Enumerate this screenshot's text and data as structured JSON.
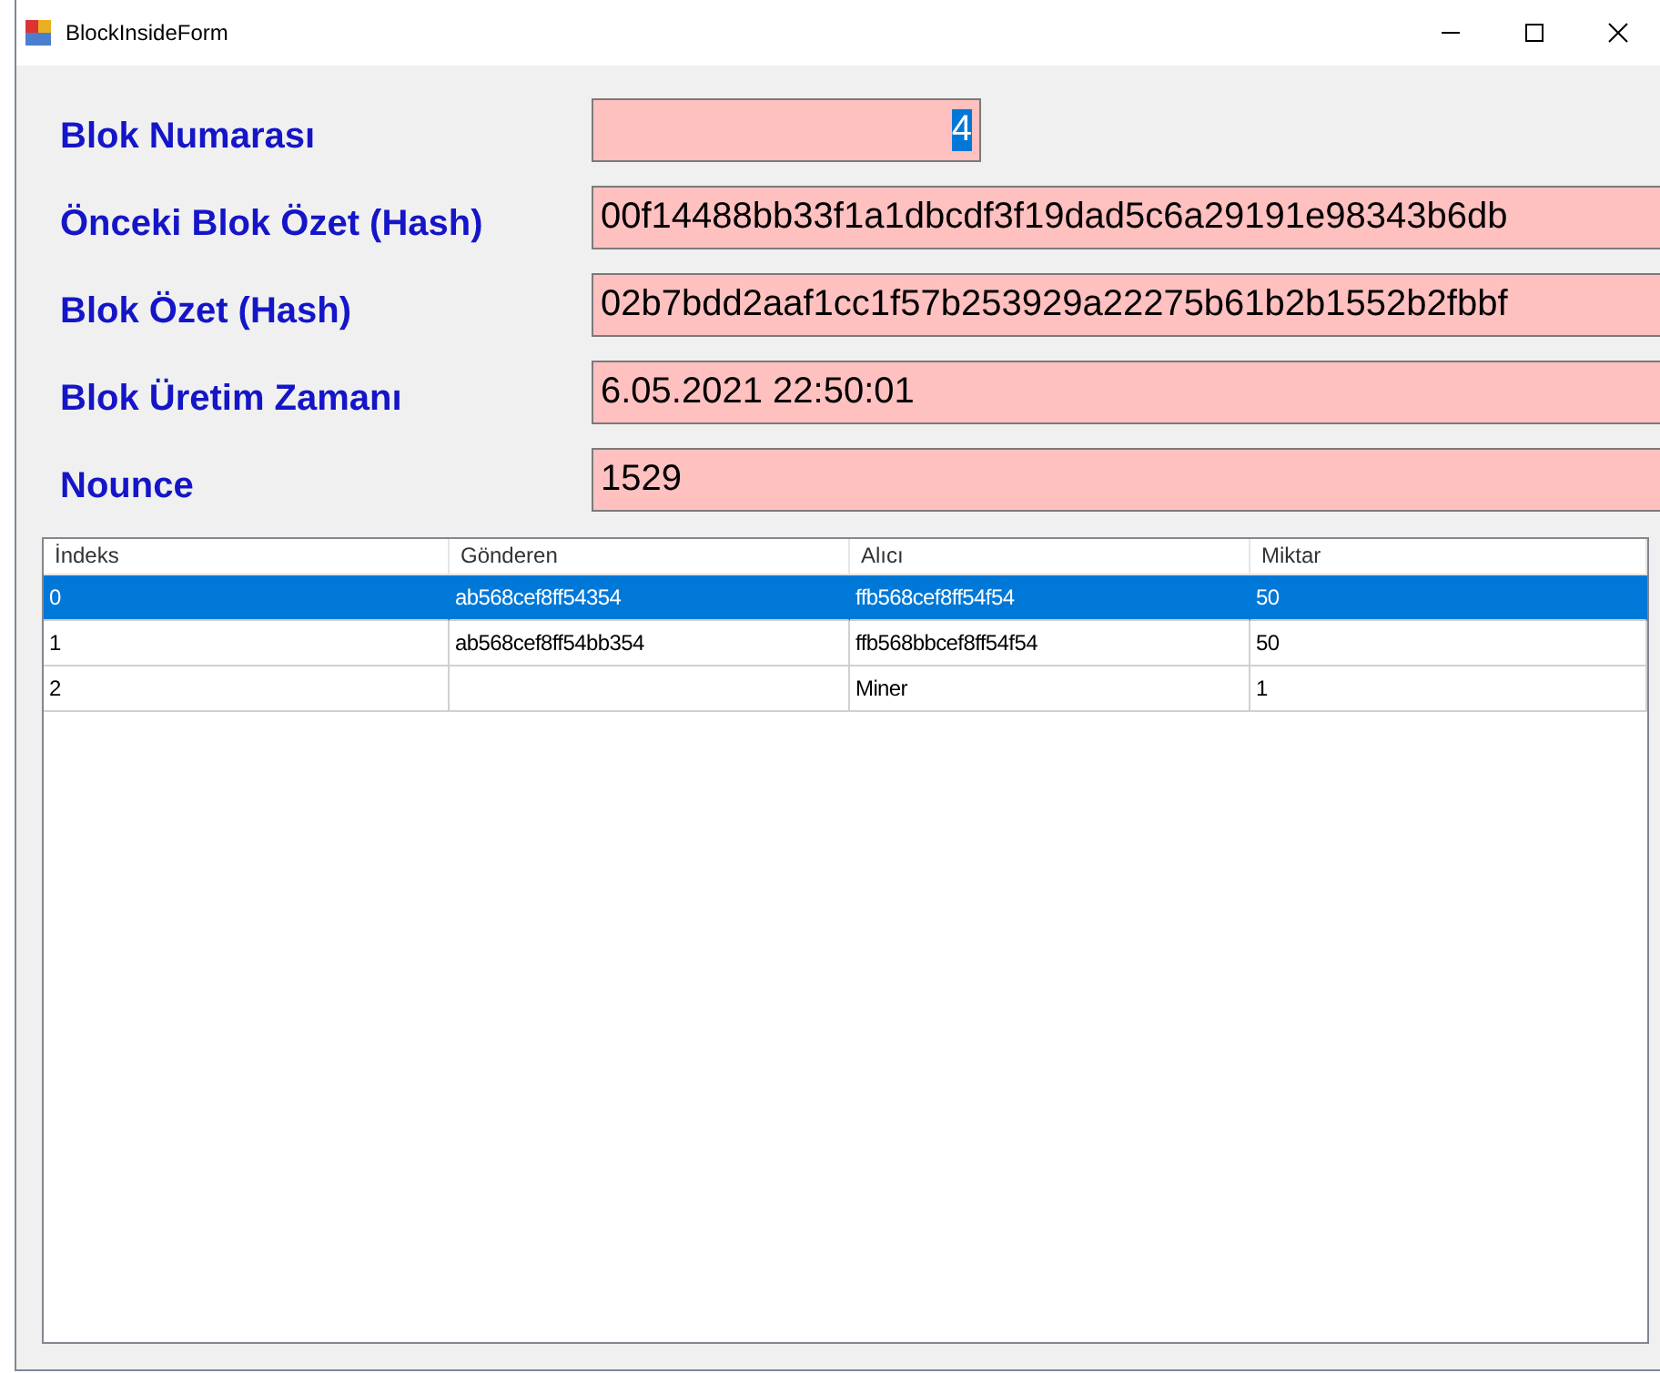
{
  "window": {
    "title": "BlockInsideForm"
  },
  "fields": [
    {
      "label": "Blok Numarası",
      "value": "4",
      "right_aligned": true,
      "text_selected": true,
      "narrow": true
    },
    {
      "label": "Önceki Blok Özet (Hash)",
      "value": "00f14488bb33f1a1dbcdf3f19dad5c6a29191e98343b6db",
      "right_aligned": false,
      "text_selected": false,
      "narrow": false
    },
    {
      "label": "Blok Özet (Hash)",
      "value": "02b7bdd2aaf1cc1f57b253929a22275b61b2b1552b2fbbf",
      "right_aligned": false,
      "text_selected": false,
      "narrow": false
    },
    {
      "label": "Blok Üretim Zamanı",
      "value": "6.05.2021 22:50:01",
      "right_aligned": false,
      "text_selected": false,
      "narrow": false
    },
    {
      "label": "Nounce",
      "value": "1529",
      "right_aligned": false,
      "text_selected": false,
      "narrow": false
    }
  ],
  "table": {
    "columns": [
      "İndeks",
      "Gönderen",
      "Alıcı",
      "Miktar"
    ],
    "rows": [
      {
        "cells": [
          "0",
          "ab568cef8ff54354",
          "ffb568cef8ff54f54",
          "50"
        ],
        "selected": true
      },
      {
        "cells": [
          "1",
          "ab568cef8ff54bb354",
          "ffb568bbcef8ff54f54",
          "50"
        ],
        "selected": false
      },
      {
        "cells": [
          "2",
          "",
          "Miner",
          "1"
        ],
        "selected": false
      }
    ]
  }
}
